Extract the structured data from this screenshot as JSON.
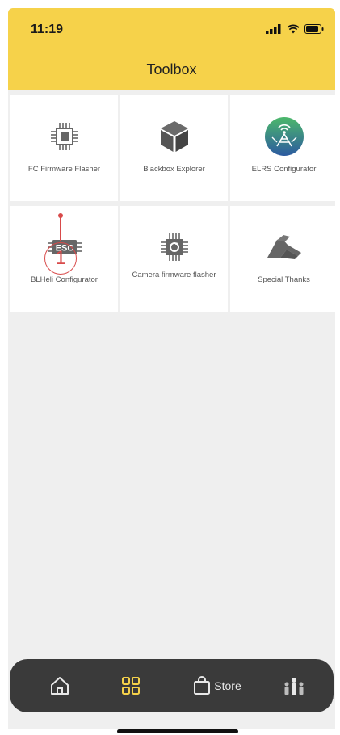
{
  "status": {
    "time": "11:19"
  },
  "header": {
    "title": "Toolbox"
  },
  "tools": [
    {
      "label": "FC Firmware Flasher",
      "icon": "chip-icon"
    },
    {
      "label": "Blackbox Explorer",
      "icon": "cube-icon"
    },
    {
      "label": "ELRS Configurator",
      "icon": "elrs-logo-icon"
    },
    {
      "label": "BLHeli Configurator",
      "icon": "esc-icon"
    },
    {
      "label": "Camera firmware flasher",
      "icon": "camera-chip-icon"
    },
    {
      "label": "Special Thanks",
      "icon": "handshake-icon"
    }
  ],
  "annotation": {
    "number": "1"
  },
  "tabbar": {
    "home_icon": "home-icon",
    "toolbox_icon": "grid-icon",
    "store_label": "Store",
    "store_icon": "bag-icon",
    "community_icon": "people-icon"
  },
  "colors": {
    "header": "#f6d24a",
    "tabbar": "#3a3a3a",
    "active_tab": "#f6d24a",
    "annotation": "#d84a4a"
  }
}
